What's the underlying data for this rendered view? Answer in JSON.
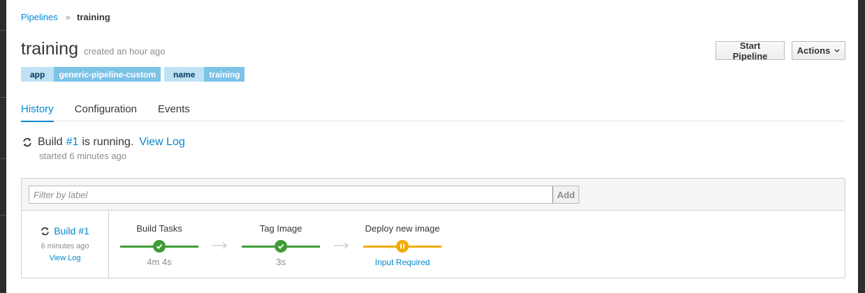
{
  "breadcrumb": {
    "parent": "Pipelines",
    "separator": "»",
    "current": "training"
  },
  "header": {
    "title": "training",
    "subtitle": "created an hour ago",
    "start_label": "Start Pipeline",
    "actions_label": "Actions"
  },
  "labels": [
    {
      "key": "app",
      "value": "generic-pipeline-custom"
    },
    {
      "key": "name",
      "value": "training"
    }
  ],
  "tabs": [
    {
      "label": "History",
      "active": true
    },
    {
      "label": "Configuration",
      "active": false
    },
    {
      "label": "Events",
      "active": false
    }
  ],
  "build_status": {
    "prefix": "Build",
    "build_link": "#1",
    "state": "is running.",
    "view_log": "View Log",
    "started": "started 6 minutes ago"
  },
  "filter": {
    "placeholder": "Filter by label",
    "add_label": "Add"
  },
  "run": {
    "title": "Build #1",
    "time": "6 minutes ago",
    "view_log": "View Log",
    "stages": [
      {
        "name": "Build Tasks",
        "status": "complete",
        "foot": "4m 4s"
      },
      {
        "name": "Tag Image",
        "status": "complete",
        "foot": "3s"
      },
      {
        "name": "Deploy new image",
        "status": "paused",
        "foot": "Input Required"
      }
    ]
  },
  "colors": {
    "link": "#0088ce",
    "success": "#3f9c35",
    "paused": "#f0ab00",
    "label_key_bg": "#bee1f4",
    "label_value_bg": "#7dc3e8"
  }
}
